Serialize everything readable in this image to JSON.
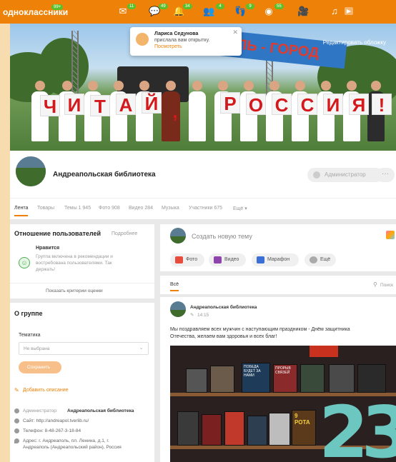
{
  "topbar": {
    "logo": "одноклассники",
    "logo_badge": "99+",
    "badges": [
      "11",
      "49",
      "34",
      "4",
      "9",
      "55"
    ]
  },
  "notification": {
    "name": "Лариса Седунова",
    "text": "прислала вам открытку.",
    "link": "Посмотреть"
  },
  "cover": {
    "banner_text": "ОЛЬ - ГОРОД",
    "slogan_letters": [
      "Ч",
      "И",
      "Т",
      "А",
      "Й",
      ",",
      "Р",
      "О",
      "С",
      "С",
      "И",
      "Я",
      "!"
    ],
    "edit_label": "Редактировать обложку"
  },
  "profile": {
    "name": "Андреапольская библиотека",
    "admin_label": "Администратор",
    "more_label": "···"
  },
  "tabs": [
    {
      "label": "Лента",
      "active": true
    },
    {
      "label": "Товары"
    },
    {
      "label": "Темы 1 945"
    },
    {
      "label": "Фото 908"
    },
    {
      "label": "Видео 284"
    },
    {
      "label": "Музыка"
    },
    {
      "label": "Участники 675"
    },
    {
      "label": "Ещё ▾"
    }
  ],
  "relations": {
    "title": "Отношение пользователей",
    "more": "Подробнее",
    "likes_title": "Нравится",
    "likes_text": [
      "Группа включена в рекомендации и",
      "востребована пользователями. Так",
      "держать!"
    ],
    "criteria": "Показать критерии оценки"
  },
  "about": {
    "title": "О группе",
    "topic_label": "Тематика",
    "topic_value": "Не выбрана",
    "save": "Сохранить",
    "add_description": "Добавить описание",
    "admin_line": "Администратор:",
    "admin_name": "Андреапольская библиотека",
    "site": "Сайт: http://andreapol.tverlib.ru/",
    "phone": "Телефон: 8-48-267-3-18-84",
    "address_1": "Адрес: г. Андреаполь, пл. Ленина, д.1, г.",
    "address_2": "Андреаполь (Андреапольский район), Россия"
  },
  "composer": {
    "placeholder": "Создать новую тему",
    "buttons": [
      "Фото",
      "Видео",
      "Марафон",
      "Ещё"
    ]
  },
  "feed": {
    "filter": "Всё",
    "search": "Поиск"
  },
  "post": {
    "author": "Андреапольская библиотека",
    "time": "14:15",
    "text_1": "Мы поздравляем всех мужчин с наступающим праздником - Днём защитника",
    "text_2": "Отечества, желаем вам здоровья и всех благ!",
    "book_titles": [
      "ПОБЕДА БУДЕТ ЗА НАМИ",
      "ПРОРЫВ СВЯЗЕЙ",
      "9 РОТА"
    ]
  },
  "colors": {
    "accent": "#ee8208",
    "badge": "#5cbf2a"
  },
  "icons": [
    "mail-icon",
    "chat-icon",
    "bell-icon",
    "friends-icon",
    "guests-icon",
    "activity-icon",
    "video-icon",
    "music-icon"
  ]
}
